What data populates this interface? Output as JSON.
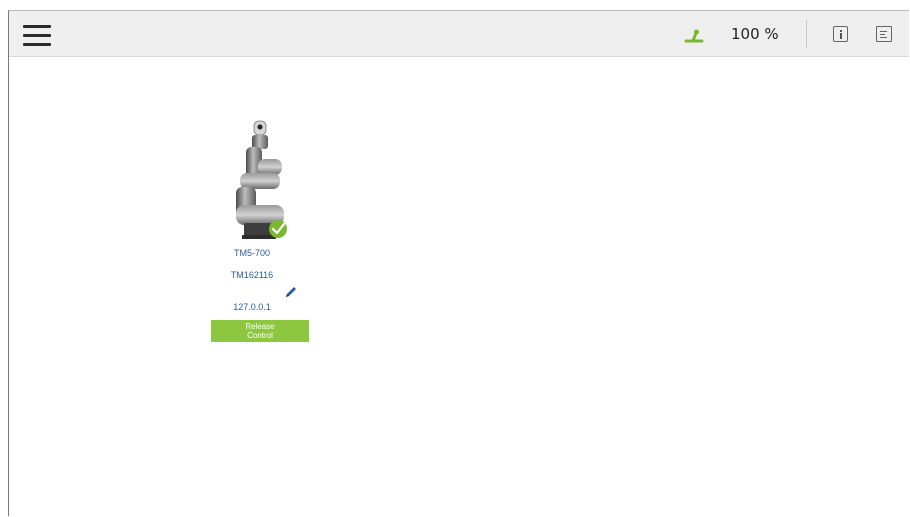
{
  "topbar": {
    "speed_value": "100 %",
    "speed_icon": "speed-indicator-icon",
    "menu_icon": "hamburger-menu-icon",
    "info_icon": "info-icon",
    "log_icon": "log-icon",
    "accent_color": "#7cb82f"
  },
  "robot": {
    "model": "TM5-700",
    "serial": "TM162116",
    "ip": "127.0.0.1",
    "status_icon": "connected-check-icon",
    "edit_icon": "edit-pencil-icon",
    "release_button_label": "Release\nControl",
    "button_color": "#8dc63f"
  }
}
